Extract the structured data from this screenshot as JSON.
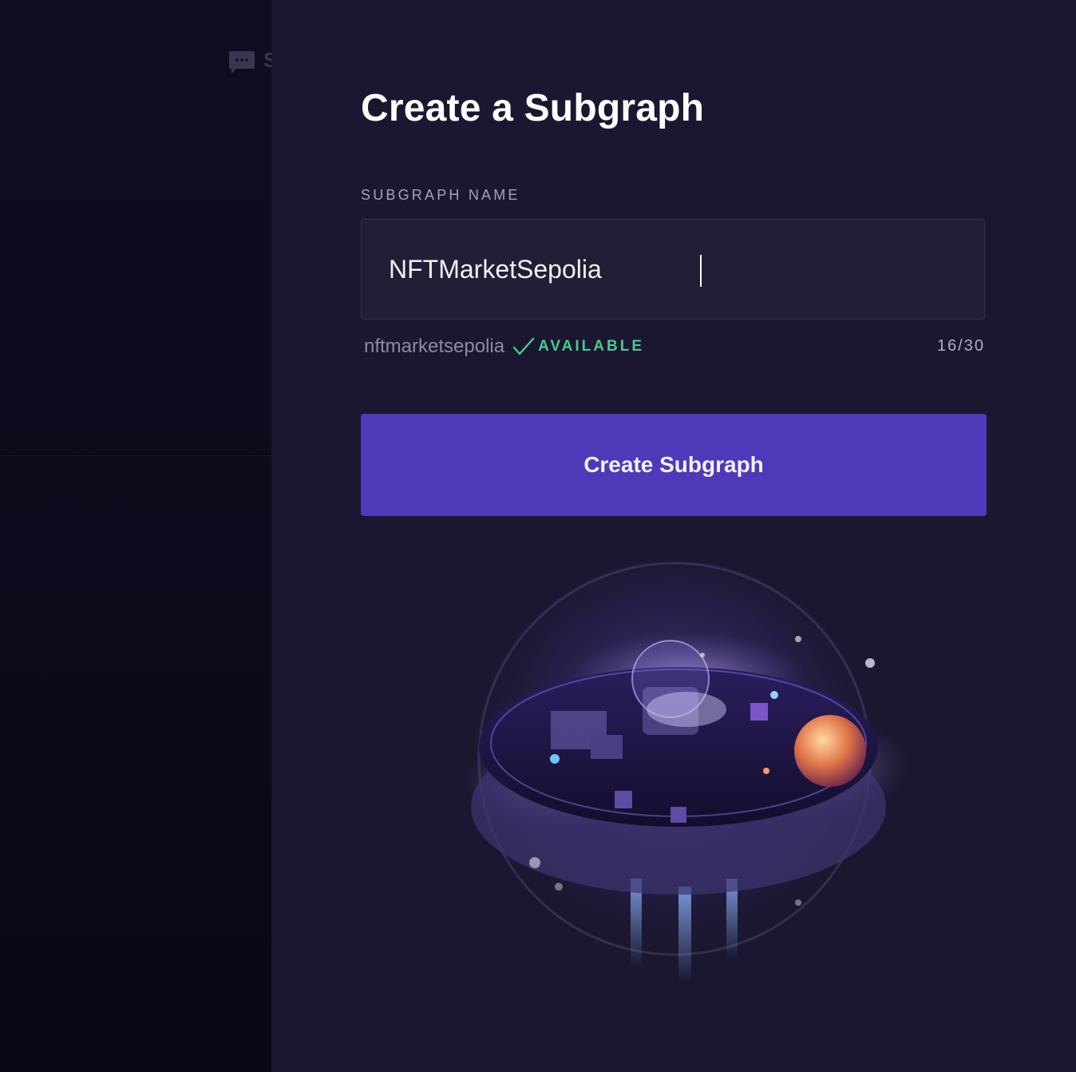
{
  "backdrop": {
    "peek_text": "S"
  },
  "dialog": {
    "title": "Create a Subgraph",
    "field_label": "SUBGRAPH NAME",
    "input_value": "NFTMarketSepolia",
    "slug": "nftmarketsepolia",
    "status": "AVAILABLE",
    "char_count": "16/30",
    "submit_label": "Create Subgraph"
  },
  "icons": {
    "chat": "chat-bubble-icon",
    "check": "checkmark-icon"
  },
  "colors": {
    "panel_bg": "#1b1730",
    "backdrop_bg": "#0c0a1b",
    "accent": "#4e39b8",
    "success": "#4bc88e"
  }
}
